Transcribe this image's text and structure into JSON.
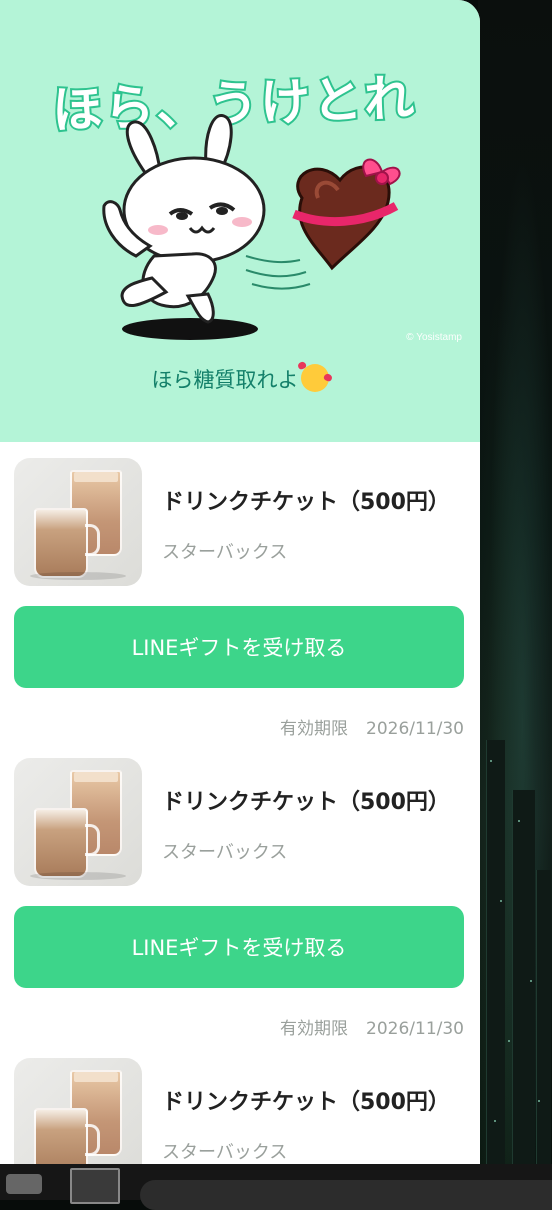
{
  "message_card": {
    "stamp_title": "ほら、うけとれ",
    "stamp_credit": "© Yosistamp",
    "message_text": "ほら糖質取れよ"
  },
  "gifts": [
    {
      "name": "ドリンクチケット（500円）",
      "brand": "スターバックス",
      "button_label": "LINEギフトを受け取る",
      "expiry_label": "有効期限",
      "expiry_date": "2026/11/30"
    },
    {
      "name": "ドリンクチケット（500円）",
      "brand": "スターバックス",
      "button_label": "LINEギフトを受け取る",
      "expiry_label": "有効期限",
      "expiry_date": "2026/11/30"
    },
    {
      "name": "ドリンクチケット（500円）",
      "brand": "スターバックス"
    }
  ],
  "colors": {
    "hero_bg": "#b4f4d7",
    "button_green": "#3dd58a",
    "message_text": "#14806a"
  },
  "icons": [
    "rabbit-sticker",
    "chocolate-heart",
    "smiling-face-with-hearts-emoji",
    "coffee-drinks-thumbnail"
  ]
}
